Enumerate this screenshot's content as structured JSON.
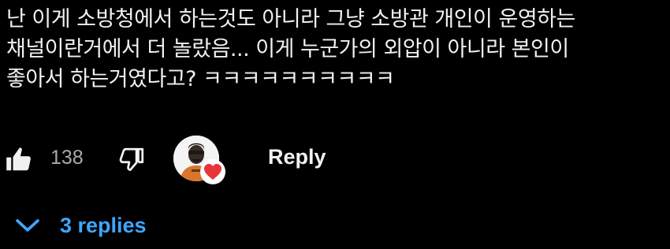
{
  "comment": {
    "lines": [
      "난 이게 소방청에서 하는것도 아니라 그냥 소방관 개인이 운영하는",
      "채널이란거에서 더 놀랐음... 이게 누군가의 외압이 아니라 본인이",
      "좋아서 하는거였다고? ㅋㅋㅋㅋㅋㅋㅋㅋㅋㅋ"
    ]
  },
  "actions": {
    "like_icon": "thumbs-up-icon",
    "like_count": "138",
    "dislike_icon": "thumbs-down-icon",
    "heart_icon": "creator-heart-icon",
    "reply_label": "Reply"
  },
  "replies": {
    "icon": "chevron-down-icon",
    "label": "3 replies"
  },
  "colors": {
    "background": "#000000",
    "text": "#f1f1f1",
    "muted": "#aaaaaa",
    "link": "#3ea6ff",
    "heart": "#e8353a",
    "avatar_shirt": "#d9762b"
  }
}
